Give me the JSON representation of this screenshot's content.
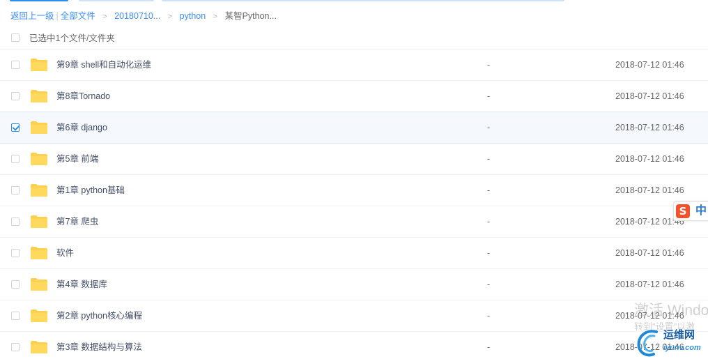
{
  "breadcrumb": {
    "back": "返回上一级",
    "pipe": "|",
    "all_files": "全部文件",
    "separator": ">",
    "items": [
      "20180710...",
      "python"
    ],
    "current": "某智Python..."
  },
  "selection": {
    "text": "已选中1个文件/文件夹",
    "checked": false
  },
  "colors": {
    "link": "#3b8cff",
    "folder": "#ffd04f",
    "selected_row_bg": "#f5f9fe",
    "checkbox_checked": "#2d8cf0"
  },
  "files": [
    {
      "name": "第9章 shell和自动化运维",
      "size": "-",
      "date": "2018-07-12 01:46",
      "checked": false,
      "icon": "folder-icon"
    },
    {
      "name": "第8章Tornado",
      "size": "-",
      "date": "2018-07-12 01:46",
      "checked": false,
      "icon": "folder-icon"
    },
    {
      "name": "第6章 django",
      "size": "-",
      "date": "2018-07-12 01:46",
      "checked": true,
      "icon": "folder-icon"
    },
    {
      "name": "第5章 前端",
      "size": "-",
      "date": "2018-07-12 01:46",
      "checked": false,
      "icon": "folder-icon"
    },
    {
      "name": "第1章 python基础",
      "size": "-",
      "date": "2018-07-12 01:46",
      "checked": false,
      "icon": "folder-icon"
    },
    {
      "name": "第7章 爬虫",
      "size": "-",
      "date": "2018-07-12 01:46",
      "checked": false,
      "icon": "folder-icon"
    },
    {
      "name": "软件",
      "size": "-",
      "date": "2018-07-12 01:46",
      "checked": false,
      "icon": "folder-icon"
    },
    {
      "name": "第4章 数据库",
      "size": "-",
      "date": "2018-07-12 01:46",
      "checked": false,
      "icon": "folder-icon"
    },
    {
      "name": "第2章 python核心编程",
      "size": "-",
      "date": "2018-07-12 01:46",
      "checked": false,
      "icon": "folder-icon"
    },
    {
      "name": "第3章 数据结构与算法",
      "size": "-",
      "date": "2018-07-12 01:46",
      "checked": false,
      "icon": "folder-icon"
    }
  ],
  "ime": {
    "logo": "S",
    "lang": "中"
  },
  "overlay": {
    "activate_line1": "激活 Windo",
    "activate_line2": "转到\"设置\"以激",
    "site_name": "运维网",
    "site_domain": "iyunv.com"
  }
}
